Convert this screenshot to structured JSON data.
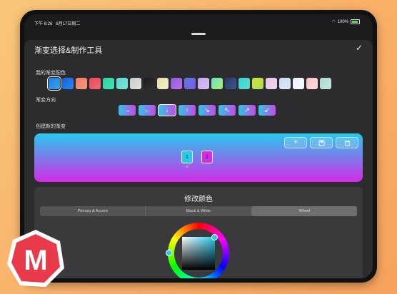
{
  "status_bar": {
    "time": "下午 6:26",
    "date": "8月17日周二",
    "battery": "100%"
  },
  "sheet": {
    "title": "渐变选择&制作工具",
    "done_icon": "checkmark-icon"
  },
  "sections": {
    "my_gradients": "我的渐变配色",
    "direction": "渐变方向",
    "create_new": "创建新的渐变"
  },
  "swatches": [
    {
      "from": "#1d7fe0",
      "to": "#3aa0f0",
      "selected": true
    },
    {
      "from": "#1460d8",
      "to": "#2a88f5"
    },
    {
      "from": "#f07a6a",
      "to": "#f59a7a"
    },
    {
      "from": "#e84a5a",
      "to": "#f06a70"
    },
    {
      "from": "#2ad4a0",
      "to": "#44e0b8"
    },
    {
      "from": "#58d6d8",
      "to": "#7ae6d0"
    },
    {
      "from": "#c8c8c8",
      "to": "#e2e2e2"
    },
    {
      "from": "#1a1a1a",
      "to": "#333333"
    },
    {
      "from": "#e6e0b0",
      "to": "#f2edc8"
    },
    {
      "from": "#8a5ae0",
      "to": "#c070e8"
    },
    {
      "from": "#5a7ae8",
      "to": "#7a5ae0"
    },
    {
      "from": "#c0a8f0",
      "to": "#d8c0f5"
    },
    {
      "from": "#6ae0c0",
      "to": "#a8f07a"
    },
    {
      "from": "#2a3a6a",
      "to": "#3a5a8a"
    },
    {
      "from": "#3ad0e0",
      "to": "#5ae0c8"
    },
    {
      "from": "#d8e030",
      "to": "#a8e05a"
    },
    {
      "from": "#e8c0e8",
      "to": "#f0d8f0"
    },
    {
      "from": "#c8d8f0",
      "to": "#e0e8f8"
    },
    {
      "from": "#e8f0f8",
      "to": "#f8fbff"
    },
    {
      "from": "#f8c0c8",
      "to": "#fcdde0"
    },
    {
      "from": "#a8d8d0",
      "to": "#c8e8e0"
    }
  ],
  "directions": [
    {
      "label": "→",
      "name": "right"
    },
    {
      "label": "←",
      "name": "left"
    },
    {
      "label": "↓",
      "name": "down",
      "selected": true
    },
    {
      "label": "↑",
      "name": "up"
    },
    {
      "label": "↘",
      "name": "down-right"
    },
    {
      "label": "↖",
      "name": "up-left"
    },
    {
      "label": "↗",
      "name": "up-right"
    },
    {
      "label": "↙",
      "name": "down-left"
    }
  ],
  "preview": {
    "colors": {
      "top": "#27c9ec",
      "bottom": "#d42be8"
    },
    "actions": {
      "add": "+",
      "save_icon": "save-icon",
      "delete_icon": "trash-icon"
    },
    "stops": [
      {
        "label": "1",
        "color": "#27c9ec"
      },
      {
        "label": "2",
        "color": "#d42be8"
      }
    ]
  },
  "editor": {
    "title": "修改颜色",
    "tabs": [
      {
        "label": "Primary & Accent"
      },
      {
        "label": "Black & White"
      },
      {
        "label": "Wheel",
        "selected": true
      }
    ],
    "current_color": "#27c9ec"
  },
  "logo": {
    "letter": "M",
    "color": "#e83a4a"
  }
}
